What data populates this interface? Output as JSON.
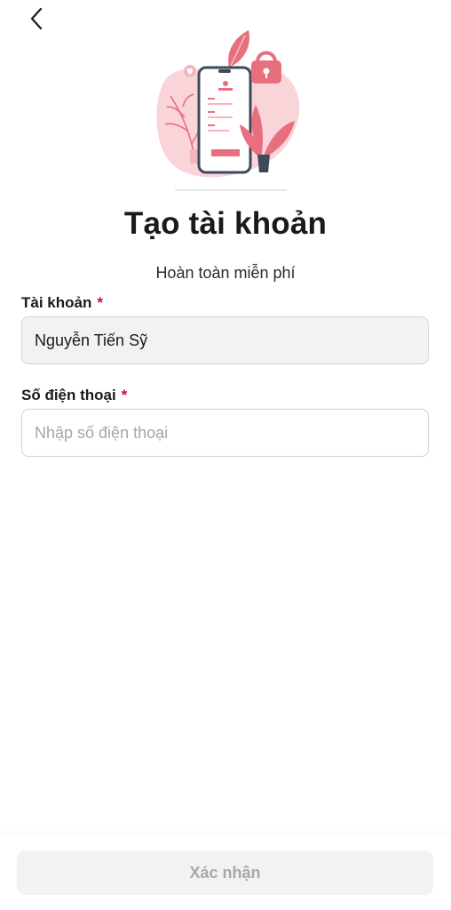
{
  "header": {
    "back_icon": "chevron-left-icon"
  },
  "hero": {
    "illustration": "phone-signup-illustration",
    "accent_color": "#e8707e",
    "blob_color": "#f9d4d9"
  },
  "page": {
    "title": "Tạo tài khoản",
    "subtitle": "Hoàn toàn miễn phí"
  },
  "form": {
    "account": {
      "label": "Tài khoản",
      "required_mark": "*",
      "value": "Nguyễn Tiến Sỹ"
    },
    "phone": {
      "label": "Số điện thoại",
      "required_mark": "*",
      "placeholder": "Nhập số điện thoại",
      "value": ""
    }
  },
  "footer": {
    "confirm_label": "Xác nhận",
    "confirm_enabled": false
  },
  "colors": {
    "required": "#c8102e",
    "text": "#1a1a1a",
    "disabled_button_bg": "#f2f2f2",
    "disabled_button_text": "#a8a8a8"
  }
}
